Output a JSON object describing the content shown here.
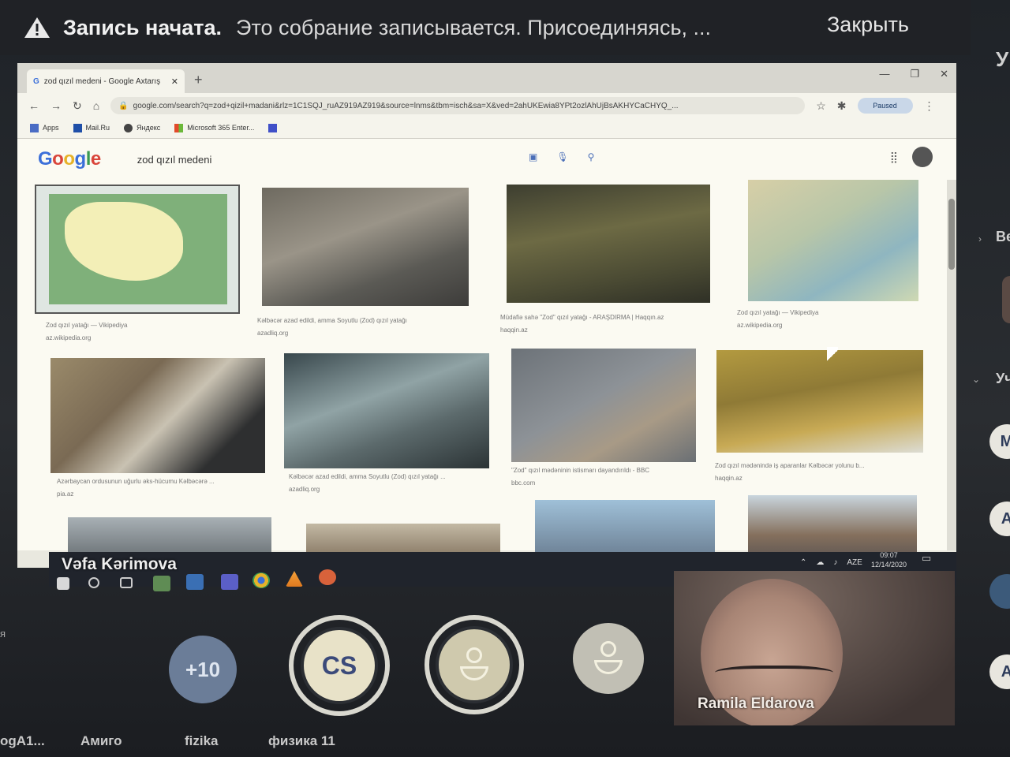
{
  "banner": {
    "title": "Запись начата.",
    "message": "Это собрание записывается. Присоединяясь, ...",
    "close_label": "Закрыть"
  },
  "browser": {
    "tab_title": "zod qızıl medeni - Google Axtarış",
    "url": "google.com/search?q=zod+qizil+madani&rlz=1C1SQJ_ruAZ919AZ919&source=lnms&tbm=isch&sa=X&ved=2ahUKEwia8YPt2ozlAhUjBsAKHYCaCHYQ_...",
    "paused_label": "Paused",
    "bookmarks": [
      "Apps",
      "Mail.Ru",
      "Яндекс",
      "Microsoft 365 Enter..."
    ]
  },
  "google": {
    "query": "zod qızıl medeni",
    "results": [
      {
        "caption": "Zod qızıl yatağı — Vikipediya",
        "source": "az.wikipedia.org"
      },
      {
        "caption": "Kəlbəcər azad edildi, amma Soyutlu (Zod) qızıl yatağı",
        "source": "azadliq.org"
      },
      {
        "caption": "Müdafiə sahə \"Zod\" qızıl yatağı - ARAŞDIRMA | Haqqın.az",
        "source": "haqqin.az"
      },
      {
        "caption": "Zod qızıl yatağı — Vikipediya",
        "source": "az.wikipedia.org"
      },
      {
        "caption": "Azərbaycan ordusunun uğurlu əks-hücumu Kəlbəcərə ...",
        "source": "pia.az"
      },
      {
        "caption": "Kəlbəcər azad edildi, amma Soyutlu (Zod) qızıl yatağı ...",
        "source": "azadliq.org"
      },
      {
        "caption": "\"Zod\" qızıl mədəninin istismarı dayandırıldı - BBC",
        "source": "bbc.com"
      },
      {
        "caption": "Zod qızıl mədənində iş aparanlar Kəlbəcər yolunu b...",
        "source": "haqqin.az"
      }
    ]
  },
  "taskbar": {
    "language": "AZE",
    "time": "09:07",
    "date": "12/14/2020"
  },
  "meeting": {
    "presenter": "Vəfa Kərimova",
    "more_count": "+10",
    "initials": "CS",
    "video_participant": "Ramila Eldarova"
  },
  "rail": {
    "top_letter": "У",
    "section_1": "Ве",
    "section_2": "Уч",
    "avatars": [
      "M",
      "A",
      "A"
    ]
  },
  "edge": {
    "left_letter": "я"
  },
  "bottom": {
    "names": [
      "ogA1...",
      "Амиго",
      "fizika",
      "физика 11"
    ]
  }
}
